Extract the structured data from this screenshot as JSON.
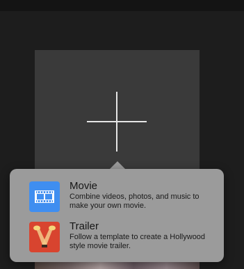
{
  "popover": {
    "items": [
      {
        "title": "Movie",
        "description": "Combine videos, photos, and music to make your own movie.",
        "icon": "film-strip-icon",
        "icon_color": "#3f8ef0"
      },
      {
        "title": "Trailer",
        "description": "Follow a template to create a Hollywood style movie trailer.",
        "icon": "spotlights-icon",
        "icon_color": "#d8442f"
      }
    ]
  },
  "new_project": {
    "icon": "plus-icon"
  }
}
